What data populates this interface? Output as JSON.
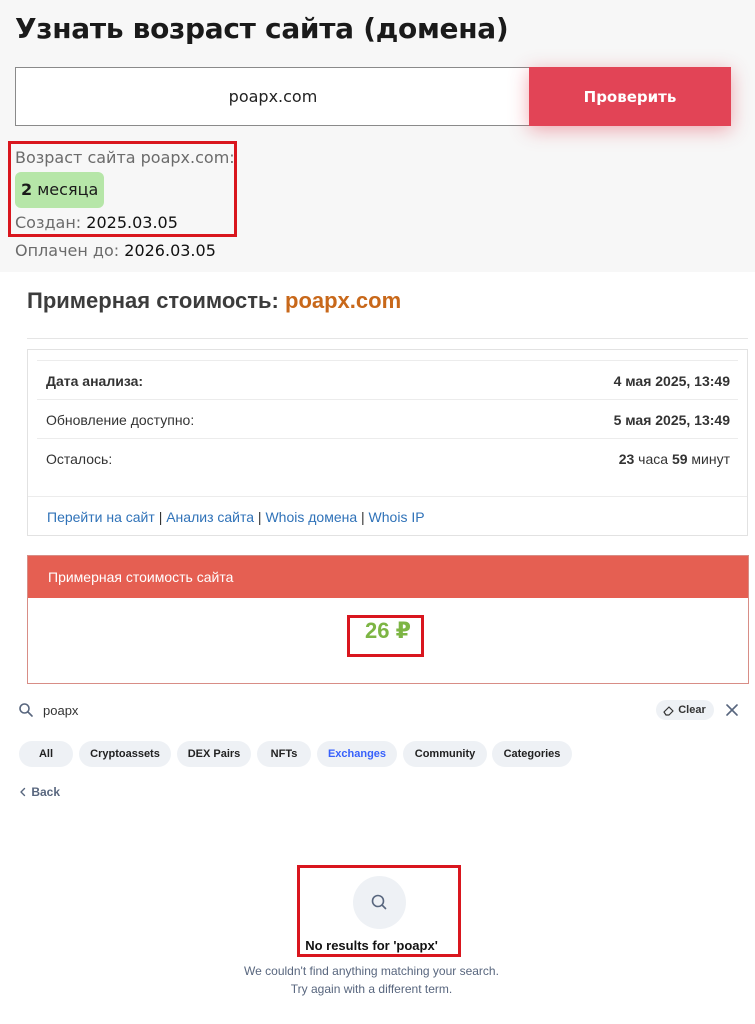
{
  "age_section": {
    "title": "Узнать возраст сайта (домена)",
    "input_value": "poapx.com",
    "check_button": "Проверить",
    "age_label": "Возраст сайта poapx.com:",
    "age_number": "2",
    "age_unit": "месяца",
    "created_label": "Создан:",
    "created_value": "2025.03.05",
    "paid_label": "Оплачен до:",
    "paid_value": "2026.03.05"
  },
  "cost_section": {
    "title_prefix": "Примерная стоимость:",
    "title_domain": "poapx.com",
    "rows": [
      {
        "label": "Дата анализа:",
        "value": "4 мая 2025, 13:49"
      },
      {
        "label": "Обновление доступно:",
        "value": "5 мая 2025, 13:49"
      },
      {
        "label": "Осталось:",
        "hours": "23",
        "hours_unit": "часа",
        "minutes": "59",
        "minutes_unit": "минут"
      }
    ],
    "links": [
      "Перейти на сайт",
      "Анализ сайта",
      "Whois домена",
      "Whois IP"
    ],
    "link_separator": "|",
    "cost_header": "Примерная стоимость сайта",
    "cost_value": "26 ₽",
    "colors": {
      "header_bg": "#e55f52",
      "value": "#7db544",
      "domain": "#c8681a",
      "accent_red": "#e24456"
    }
  },
  "search": {
    "query": "poapx",
    "clear_label": "Clear",
    "tabs": [
      "All",
      "Cryptoassets",
      "DEX Pairs",
      "NFTs",
      "Exchanges",
      "Community",
      "Categories"
    ],
    "active_tab": "Exchanges",
    "back_label": "Back",
    "no_results_title": "No results for 'poapx'",
    "no_results_line1": "We couldn't find anything matching your search.",
    "no_results_line2": "Try again with a different term.",
    "icons": [
      "search-icon",
      "eraser-icon",
      "close-icon",
      "chevron-left-icon"
    ]
  }
}
